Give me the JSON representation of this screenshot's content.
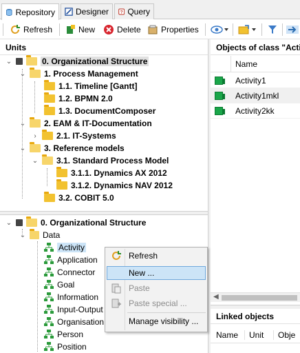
{
  "tabs": [
    {
      "label": "Repository",
      "icon": "repository-icon"
    },
    {
      "label": "Designer",
      "icon": "designer-icon"
    },
    {
      "label": "Query",
      "icon": "query-icon"
    }
  ],
  "toolbar": {
    "refresh": "Refresh",
    "new": "New",
    "delete": "Delete",
    "properties": "Properties"
  },
  "units_panel": {
    "title": "Units",
    "tree": [
      {
        "label": "0. Organizational Structure",
        "bold": true
      },
      {
        "label": "1. Process Management",
        "bold": true
      },
      {
        "label": "1.1. Timeline [Gantt]",
        "bold": true
      },
      {
        "label": "1.2. BPMN 2.0",
        "bold": true
      },
      {
        "label": "1.3. DocumentComposer",
        "bold": true
      },
      {
        "label": "2. EAM & IT-Documentation",
        "bold": true
      },
      {
        "label": "2.1. IT-Systems",
        "bold": true
      },
      {
        "label": "3. Reference models",
        "bold": true
      },
      {
        "label": "3.1. Standard Process Model",
        "bold": true
      },
      {
        "label": "3.1.1. Dynamics AX 2012",
        "bold": true
      },
      {
        "label": "3.1.2. Dynamics NAV 2012",
        "bold": true
      },
      {
        "label": "3.2. COBIT 5.0",
        "bold": true
      }
    ]
  },
  "classes_panel": {
    "root": "0. Organizational Structure",
    "data_folder": "Data",
    "items": [
      "Activity",
      "Application",
      "Connector",
      "Goal",
      "Information",
      "Input-Output",
      "Organisation",
      "Person",
      "Position"
    ]
  },
  "objects_panel": {
    "title": "Objects of class \"Activi",
    "column": "Name",
    "rows": [
      "Activity1",
      "Activity1mkl",
      "Activity2kk"
    ]
  },
  "linked_panel": {
    "title": "Linked objects",
    "columns": [
      "Name",
      "Unit",
      "Obje"
    ]
  },
  "context_menu": {
    "items": [
      {
        "label": "Refresh",
        "icon": "refresh-icon",
        "enabled": true
      },
      {
        "label": "New ...",
        "icon": "",
        "enabled": true,
        "highlighted": true
      },
      {
        "label": "Paste",
        "icon": "paste-icon",
        "enabled": false
      },
      {
        "label": "Paste special ...",
        "icon": "paste-special-icon",
        "enabled": false
      },
      {
        "label": "Manage visibility ...",
        "icon": "",
        "enabled": true
      }
    ]
  }
}
